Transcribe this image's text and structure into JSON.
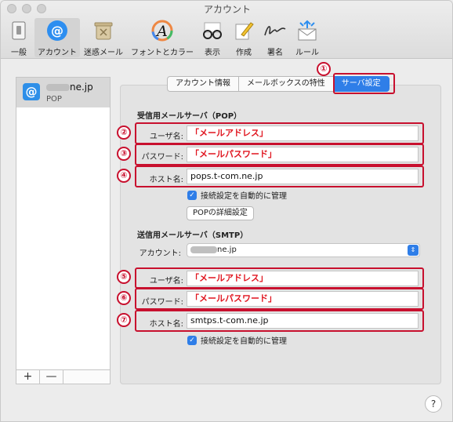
{
  "window": {
    "title": "アカウント"
  },
  "toolbar": {
    "items": [
      {
        "label": "一般",
        "icon": "switch-icon"
      },
      {
        "label": "アカウント",
        "icon": "at-icon"
      },
      {
        "label": "迷惑メール",
        "icon": "trash-bin-icon"
      },
      {
        "label": "フォントとカラー",
        "icon": "font-color-icon"
      },
      {
        "label": "表示",
        "icon": "glasses-icon"
      },
      {
        "label": "作成",
        "icon": "pencil-icon"
      },
      {
        "label": "署名",
        "icon": "signature-icon"
      },
      {
        "label": "ルール",
        "icon": "envelope-arrows-icon"
      }
    ],
    "selected": "アカウント"
  },
  "sidebar": {
    "account": {
      "name_suffix": "ne.jp",
      "type": "POP"
    },
    "add_label": "+",
    "remove_label": "—"
  },
  "tabs": [
    {
      "label": "アカウント情報"
    },
    {
      "label": "メールボックスの特性"
    },
    {
      "label": "サーバ設定"
    }
  ],
  "incoming": {
    "title": "受信用メールサーバ（POP）",
    "user_label": "ユーザ名:",
    "user_value": "「メールアドレス」",
    "password_label": "パスワード:",
    "password_value": "「メールパスワード」",
    "host_label": "ホスト名:",
    "host_value": "pops.t-com.ne.jp",
    "auto_label": "接続設定を自動的に管理",
    "detail_button": "POPの詳細設定"
  },
  "outgoing": {
    "title": "送信用メールサーバ（SMTP）",
    "account_label": "アカウント:",
    "account_value_suffix": "ne.jp",
    "user_label": "ユーザ名:",
    "user_value": "「メールアドレス」",
    "password_label": "パスワード:",
    "password_value": "「メールパスワード」",
    "host_label": "ホスト名:",
    "host_value": "smtps.t-com.ne.jp",
    "auto_label": "接続設定を自動的に管理"
  },
  "badges": [
    "①",
    "②",
    "③",
    "④",
    "⑤",
    "⑥",
    "⑦"
  ],
  "help_label": "?",
  "colors": {
    "accent": "#2f7ee8",
    "annotation": "#c8102e",
    "value_red": "#e0141e"
  }
}
